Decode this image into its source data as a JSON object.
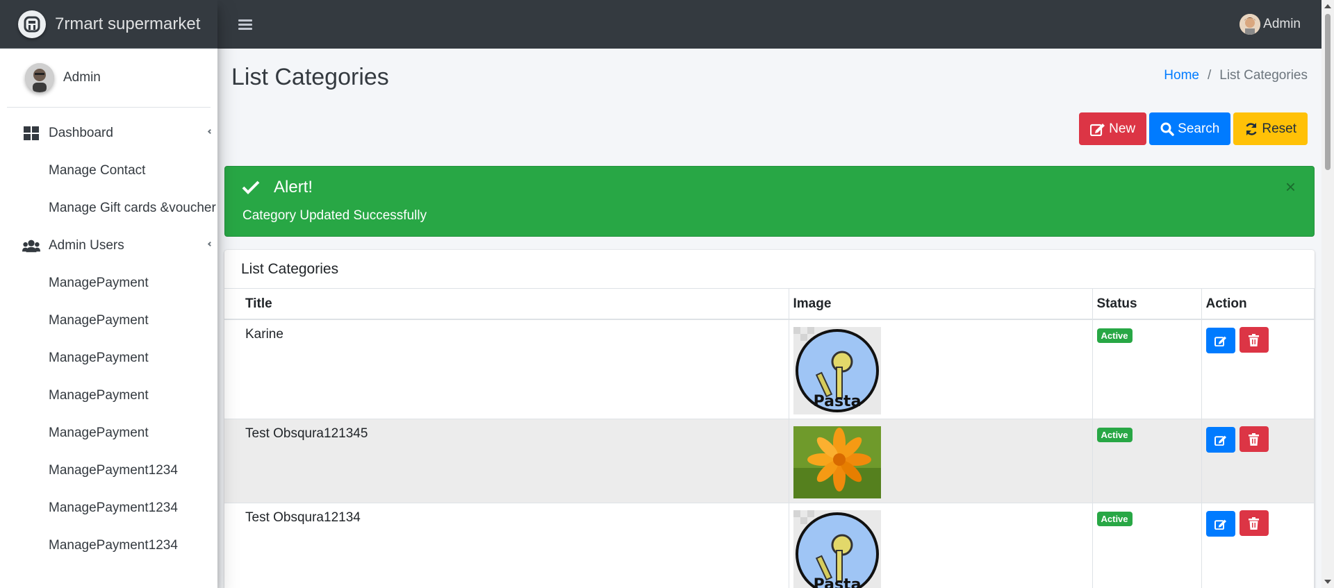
{
  "brand": {
    "name": "7rmart supermarket"
  },
  "sidebar": {
    "user_name": "Admin",
    "items": [
      {
        "label": "Dashboard",
        "type": "top",
        "icon": "dashboard-icon"
      },
      {
        "label": "Manage Contact",
        "type": "sub"
      },
      {
        "label": "Manage Gift cards &voucher",
        "type": "sub"
      },
      {
        "label": "Admin Users",
        "type": "top",
        "icon": "users-icon"
      },
      {
        "label": "ManagePayment",
        "type": "sub"
      },
      {
        "label": "ManagePayment",
        "type": "sub"
      },
      {
        "label": "ManagePayment",
        "type": "sub"
      },
      {
        "label": "ManagePayment",
        "type": "sub"
      },
      {
        "label": "ManagePayment",
        "type": "sub"
      },
      {
        "label": "ManagePayment1234",
        "type": "sub"
      },
      {
        "label": "ManagePayment1234",
        "type": "sub"
      },
      {
        "label": "ManagePayment1234",
        "type": "sub"
      }
    ]
  },
  "topbar": {
    "user_name": "Admin"
  },
  "page": {
    "title": "List Categories",
    "breadcrumb": {
      "home": "Home",
      "separator": "/",
      "current": "List Categories"
    }
  },
  "buttons": {
    "new": "New",
    "search": "Search",
    "reset": "Reset"
  },
  "alert": {
    "title": "Alert!",
    "message": "Category Updated Successfully",
    "close": "×"
  },
  "table": {
    "card_title": "List Categories",
    "headers": {
      "title": "Title",
      "image": "Image",
      "status": "Status",
      "action": "Action"
    },
    "rows": [
      {
        "title": "Karine",
        "image": "pasta-keys-image",
        "status": "Active"
      },
      {
        "title": "Test Obsqura121345",
        "image": "orange-flower-image",
        "status": "Active"
      },
      {
        "title": "Test Obsqura12134",
        "image": "pasta-keys-image",
        "status": "Active"
      }
    ]
  },
  "colors": {
    "topbar": "#343a40",
    "primary": "#007bff",
    "danger": "#dc3545",
    "warning": "#ffc107",
    "success": "#28a745"
  }
}
